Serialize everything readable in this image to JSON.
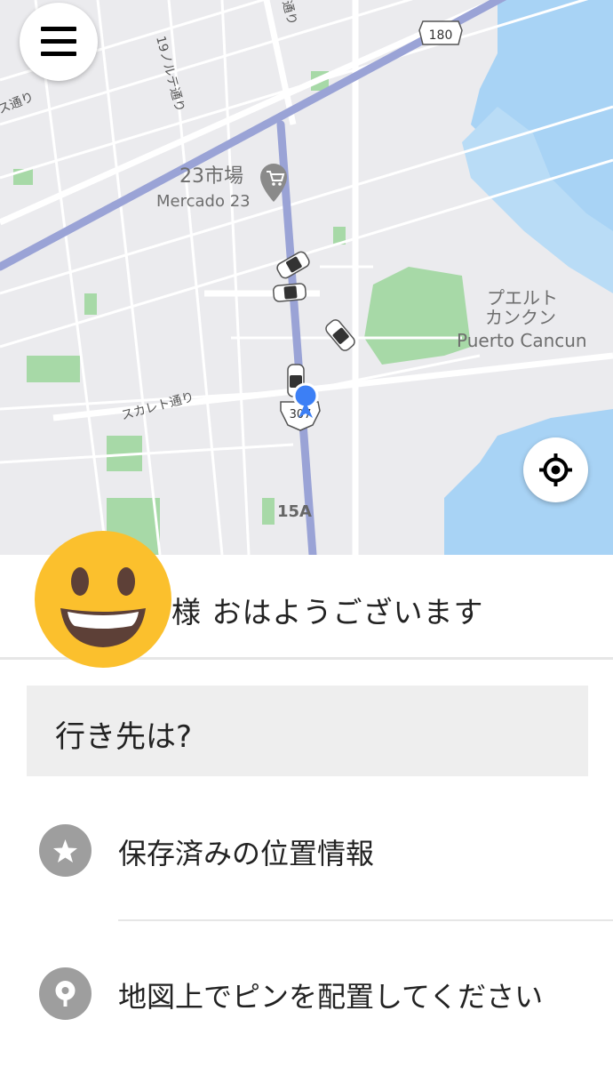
{
  "map": {
    "labels": {
      "market_ja": "23市場",
      "market_es": "Mercado 23",
      "place_ja_1": "プエルト",
      "place_ja_2": "カンクン",
      "place_en": "Puerto Cancun",
      "street_1": "19ノルテ通り",
      "street_2": "スカレト通り",
      "street_3": "ス通り",
      "street_4": "通り",
      "exit": "15A"
    },
    "route_shields": [
      "180",
      "307"
    ],
    "colors": {
      "land": "#ebebee",
      "road": "#ffffff",
      "highway": "#9aa3d6",
      "park": "#a7d9a7",
      "water": "#a8d3f5"
    }
  },
  "menu": {
    "icon": "hamburger-menu-icon"
  },
  "locate": {
    "icon": "crosshair-icon"
  },
  "greeting": {
    "text": "様  おはようございます",
    "avatar_icon": "smiling-face-emoji"
  },
  "search": {
    "label": "行き先は?"
  },
  "options": [
    {
      "label": "保存済みの位置情報",
      "icon": "star-icon"
    },
    {
      "label": "地図上でピンを配置してください",
      "icon": "map-pin-icon"
    }
  ]
}
